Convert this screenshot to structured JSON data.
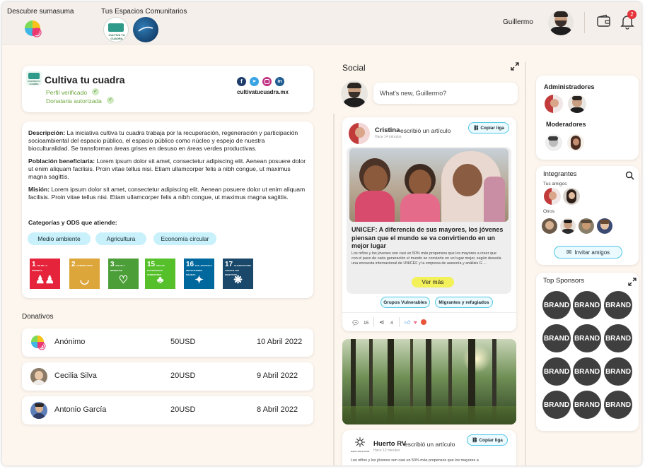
{
  "topbar": {
    "discover_label": "Descubre sumasuma",
    "spaces_label": "Tus Espacios Comunitarios",
    "space_logo_text": "CULTIVA TU CUADRA",
    "user_name": "Guillermo",
    "notification_count": "2"
  },
  "profile": {
    "name": "Cultiva tu cuadra",
    "logo_text": "CULTIVA TU CUADRA",
    "verified": "Perfil verificado",
    "donee": "Donataria autorizada",
    "website": "cultivatucuadra.mx",
    "social_icons": [
      "facebook-icon",
      "twitter-icon",
      "instagram-icon",
      "linkedin-icon"
    ]
  },
  "about": {
    "description_label": "Descripción:",
    "description_text": " La iniciativa cultiva tu cuadra trabaja por la recuperación, regeneración y participación socioambiental del espacio público, el espacio público como núcleo y espejo de nuestra bioculturalidad. Se transforman áreas grises en desuso en áreas verdes productivas.",
    "population_label": "Población beneficiaria:",
    "population_text": " Lorem ipsum dolor sit amet, consectetur adipiscing elit. Aenean posuere dolor ut enim aliquam facilisis. Proin vitae tellus nisi. Etiam ullamcorper felis a nibh congue, ut maximus magna sagittis.",
    "mission_label": "Misión:",
    "mission_text": " Lorem ipsum dolor sit amet, consectetur adipiscing elit. Aenean posuere dolor ut enim aliquam facilisis. Proin vitae tellus nisi. Etiam ullamcorper felis a nibh congue, ut maximus magna sagittis.",
    "categories_title": "Categorías y ODS que atiende:",
    "categories": [
      "Medio ambiente",
      "Agricultura",
      "Economía circular"
    ],
    "sdgs": [
      {
        "num": "1",
        "title": "FIN DE LA POBREZA",
        "color": "#e5243b",
        "glyph": "♟♟"
      },
      {
        "num": "2",
        "title": "HAMBRE CERO",
        "color": "#dda63a",
        "glyph": "◡"
      },
      {
        "num": "3",
        "title": "SALUD Y BIENESTAR",
        "color": "#4c9f38",
        "glyph": "♡"
      },
      {
        "num": "15",
        "title": "VIDA DE ECOSISTEMAS TERRESTRES",
        "color": "#56c02b",
        "glyph": "♣"
      },
      {
        "num": "16",
        "title": "PAZ, JUSTICIA E INSTITUCIONES SÓLIDAS",
        "color": "#00689d",
        "glyph": "✦"
      },
      {
        "num": "17",
        "title": "ALIANZAS PARA LOGRAR LOS OBJETIVOS",
        "color": "#19486a",
        "glyph": "❋"
      }
    ]
  },
  "donations": {
    "title": "Donativos",
    "rows": [
      {
        "name": "Anónimo",
        "amount": "50USD",
        "date": "10 Abril 2022"
      },
      {
        "name": "Cecilia Silva",
        "amount": "20USD",
        "date": "9 Abril 2022"
      },
      {
        "name": "Antonio García",
        "amount": "20USD",
        "date": "8 Abril 2022"
      }
    ]
  },
  "social": {
    "title": "Social",
    "composer_placeholder": "What's new, Guillermo?",
    "post1": {
      "author": "Cristina",
      "action": " escribió un artículo",
      "time": "Hace 14 minutos",
      "copy_label": "Copiar liga",
      "headline": "UNICEF: A diferencia de sus mayores, los jóvenes piensan que el mundo se va convirtiendo en un mejor lugar",
      "excerpt": "Los niños y los jóvenes son casi un 50% más propensos que los mayores a creer que con el paso de cada generación el mundo se convierte en un lugar mejor, según desvela una encuesta internacional de UNICEF y la empresa de asesoría y análisis G ...",
      "more_label": "Ver más",
      "tags": [
        "Grupos Vulnerables",
        "Migrantes y refugiados"
      ],
      "comments": "15",
      "shares": "4"
    },
    "post2": {
      "author": "Huerto RV",
      "action": "escribió un artículo",
      "time": "Hace 12 minutos",
      "copy_label": "Copiar liga",
      "logo_text": "Huerto Roma Verde",
      "excerpt": "Los niños y los jóvenes son casi un 50% más propensos que los mayores a"
    }
  },
  "right": {
    "admins_title": "Administradores",
    "mods_title": "Moderadores",
    "members_title": "Integrantes",
    "friends_label": "Tus amigos",
    "others_label": "Otros",
    "invite_label": "Invitar amigos",
    "sponsors_title": "Top Sponsors",
    "brand_label": "BRAND"
  }
}
